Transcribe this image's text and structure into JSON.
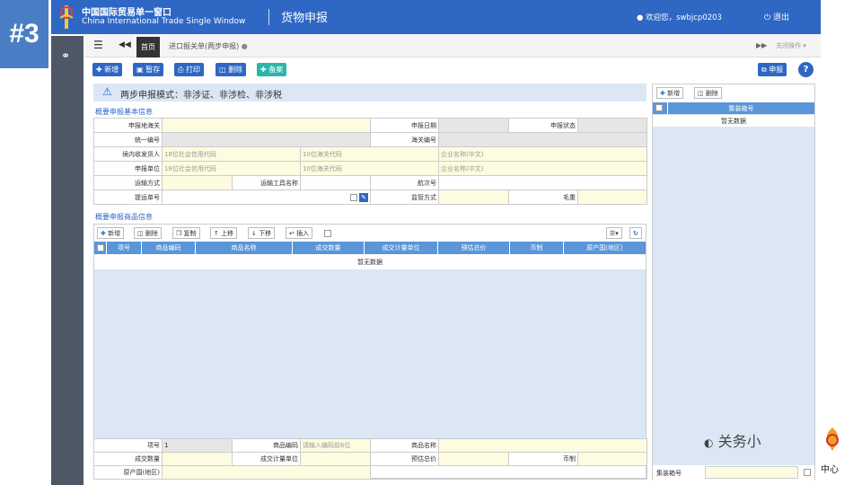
{
  "slide_badge": "#3",
  "header": {
    "cn_title": "中国国际贸易单一窗口",
    "en_title": "China International Trade Single Window",
    "module": "货物申报",
    "welcome": "欢迎您，swbjcp0203",
    "logout": "退出",
    "colors": {
      "bar": "#2e67c4"
    }
  },
  "tabs": {
    "home": "首页",
    "current": "进口报关单(两步申报)",
    "close_ops": "关闭操作"
  },
  "toolbar": {
    "new": "新增",
    "save": "暂存",
    "print": "打印",
    "delete": "删除",
    "record": "备案",
    "declare": "申报",
    "help": "?"
  },
  "mode_text": "两步申报模式：非涉证、非涉检、非涉税",
  "section1": "概要申报基本信息",
  "form": {
    "declare_customs": "申报地海关",
    "declare_date": "申报日期",
    "declare_status": "申报状态",
    "unified_no": "统一编号",
    "customs_no": "海关编号",
    "consignee": "境内收发货人",
    "declarant": "申报单位",
    "ph_credit": "18位社会信用代码",
    "ph_customs10": "10位海关代码",
    "ph_company": "企业名称(中文)",
    "transport_mode": "运输方式",
    "transport_name": "运输工具名称",
    "voyage_no": "航次号",
    "bill_no": "提运单号",
    "supervision": "监管方式",
    "gross_weight": "毛重"
  },
  "section2": "概要申报商品信息",
  "goods_toolbar": {
    "new": "新增",
    "delete": "删除",
    "copy": "复制",
    "up": "上移",
    "down": "下移",
    "insert": "插入"
  },
  "goods_columns": [
    "项号",
    "商品编码",
    "商品名称",
    "成交数量",
    "成交计量单位",
    "预估总价",
    "币制",
    "原产国(地区)"
  ],
  "no_data": "暂无数据",
  "bottom_form": {
    "item_no": "项号",
    "item_no_value": "1",
    "hs_code": "商品编码",
    "hs_placeholder": "请输入编码前6位",
    "goods_name": "商品名称",
    "qty": "成交数量",
    "unit": "成交计量单位",
    "est_total": "预估总价",
    "currency": "币制",
    "origin": "原产国(地区)"
  },
  "right_panel": {
    "new": "新增",
    "delete": "删除",
    "column": "集装箱号",
    "no_data": "暂无数据",
    "footer_label": "集装箱号"
  },
  "watermark": {
    "text": "关务小",
    "text2": "中心"
  }
}
